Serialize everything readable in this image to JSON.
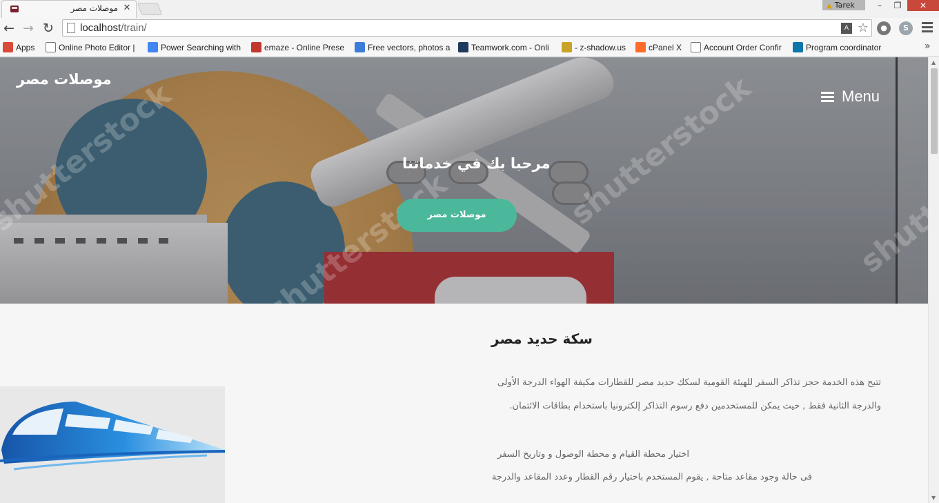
{
  "browser": {
    "tab_title": "موصلات مصر",
    "tab_close": "✕",
    "user_name": "Tarek",
    "window_min": "–",
    "window_max": "❐",
    "window_close": "✕",
    "url_host": "localhost",
    "url_path": "/train/",
    "bookmarks": [
      {
        "label": "Apps",
        "icon": "apps-grid-icon",
        "color": "#d94a38"
      },
      {
        "label": "Online Photo Editor | ",
        "icon": "page-icon",
        "color": "#ffffff"
      },
      {
        "label": "Power Searching with",
        "icon": "google-icon",
        "color": "#4285f4"
      },
      {
        "label": "emaze - Online Prese",
        "icon": "emaze-icon",
        "color": "#c0392b"
      },
      {
        "label": "Free vectors, photos a",
        "icon": "freepik-icon",
        "color": "#3b7dd8"
      },
      {
        "label": "Teamwork.com - Onli",
        "icon": "teamwork-icon",
        "color": "#1e3a5f"
      },
      {
        "label": "- z-shadow.us",
        "icon": "zshadow-icon",
        "color": "#c9a227"
      },
      {
        "label": "cPanel X",
        "icon": "cpanel-icon",
        "color": "#ff6c2c"
      },
      {
        "label": "Account Order Confir",
        "icon": "page-icon",
        "color": "#ffffff"
      },
      {
        "label": "Program coordinator ",
        "icon": "linkedin-icon",
        "color": "#0e76a8"
      }
    ],
    "bookmarks_more": "»"
  },
  "header": {
    "brand": "موصلات مصر",
    "menu_label": "Menu"
  },
  "hero": {
    "heading": "مرحبا بك في خدماتنا",
    "button_label": "موصلات مصر",
    "watermark": "shutterstock"
  },
  "content": {
    "title": "سكة حديد مصر",
    "paragraphs": [
      "تتيح هذه الخدمة حجز تذاكر السفر للهيئة القومية لسكك حديد مصر للقطارات مكيفة الهواء الدرجة الأولى",
      "والدرجة الثانية فقط , حيث يمكن للمستخدمين دفع رسوم التذاكر إلكترونيا باستخدام بطاقات الائتمان.",
      "اختيار محطة القيام و محطة الوصول و وتاريخ السفر",
      "فى حالة وجود مقاعد متاحة , يقوم المستخدم باختيار رقم القطار وعدد المقاعد والدرجة"
    ]
  },
  "colors": {
    "accent": "#4bb89b",
    "train_blue": "#1f6fc4"
  }
}
